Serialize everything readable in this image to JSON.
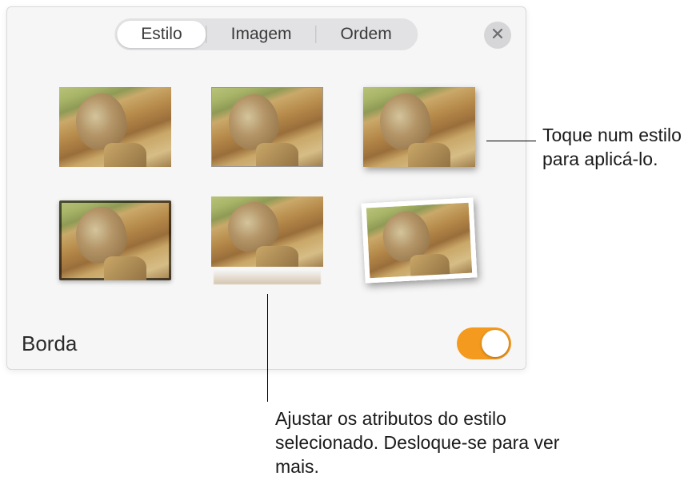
{
  "tabs": {
    "style": "Estilo",
    "image": "Imagem",
    "order": "Ordem",
    "active": "style"
  },
  "section": {
    "borda_label": "Borda",
    "borda_on": true
  },
  "style_options": [
    {
      "id": "style-none",
      "name": "no-border"
    },
    {
      "id": "style-thin",
      "name": "thin-border"
    },
    {
      "id": "style-shadow",
      "name": "drop-shadow"
    },
    {
      "id": "style-frame",
      "name": "dark-frame"
    },
    {
      "id": "style-reflect",
      "name": "reflection"
    },
    {
      "id": "style-polaroid",
      "name": "polaroid-tilt"
    }
  ],
  "callouts": {
    "tap_style": "Toque num estilo para aplicá-lo.",
    "adjust_attrs": "Ajustar os atributos do estilo selecionado. Desloque-se para ver mais."
  },
  "colors": {
    "accent": "#f39a1f"
  }
}
